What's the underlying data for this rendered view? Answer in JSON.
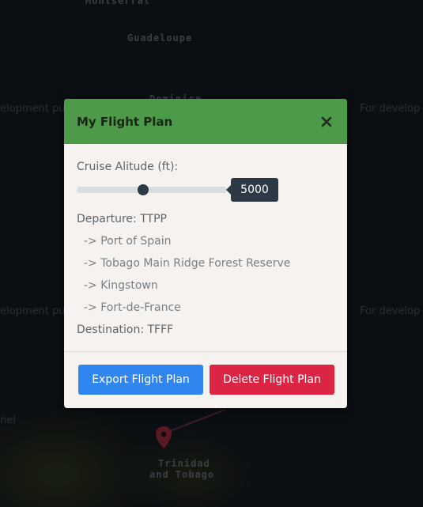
{
  "map": {
    "labels": {
      "top_left_clipped": "Montserrat",
      "guadeloupe": "Guadeloupe",
      "dominica": "Dominica",
      "dev_left_1": "elopment pu",
      "dev_right_1": "For develop",
      "dev_left_2": "elopment pu",
      "dev_right_2": "For develop",
      "bottom_left": "nel",
      "trinidad": "Trinidad",
      "and_tobago": "and Tobago"
    }
  },
  "modal": {
    "title": "My Flight Plan",
    "close_symbol": "×",
    "cruise_label": "Cruise Alitude (ft):",
    "cruise_value": "5000",
    "route": {
      "departure": "Departure: TTPP",
      "waypoints": [
        "-> Port of Spain",
        "-> Tobago Main Ridge Forest Reserve",
        "-> Kingstown",
        "-> Fort-de-France"
      ],
      "destination": "Destination: TFFF"
    },
    "buttons": {
      "export": "Export Flight Plan",
      "delete": "Delete Flight Plan"
    }
  },
  "colors": {
    "header": "#4d9a48",
    "export_button": "#2e86ee",
    "delete_button": "#dc2444",
    "value_badge": "#2d3a45"
  }
}
